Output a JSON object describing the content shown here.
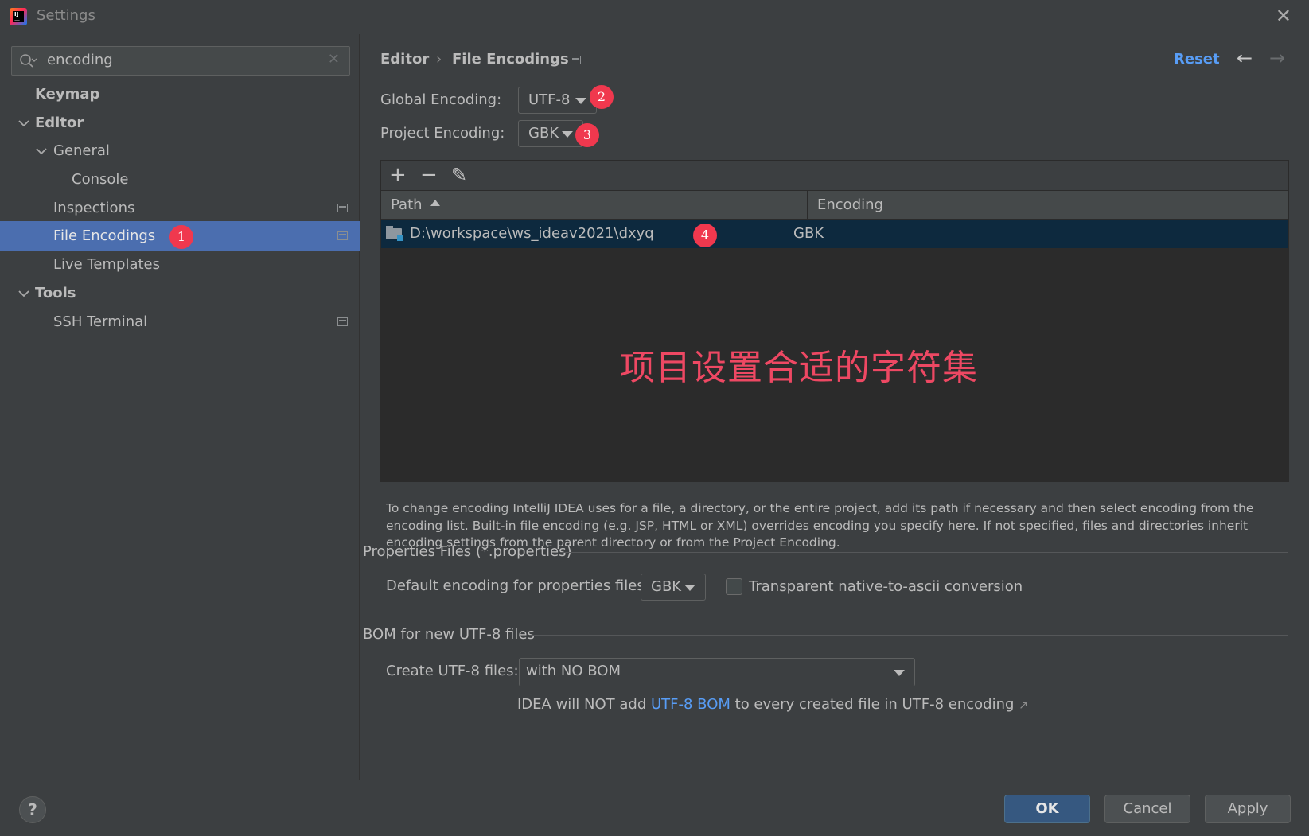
{
  "window": {
    "title": "Settings",
    "close_glyph": "✕"
  },
  "search": {
    "value": "encoding",
    "clear_glyph": "✕"
  },
  "sidebar": {
    "items": [
      {
        "label": "Keymap"
      },
      {
        "label": "Editor"
      },
      {
        "label": "General"
      },
      {
        "label": "Console"
      },
      {
        "label": "Inspections"
      },
      {
        "label": "File Encodings"
      },
      {
        "label": "Live Templates"
      },
      {
        "label": "Tools"
      },
      {
        "label": "SSH Terminal"
      }
    ]
  },
  "header": {
    "breadcrumb_parent": "Editor",
    "breadcrumb_sep": "›",
    "breadcrumb_current": "File Encodings",
    "reset_label": "Reset",
    "back_glyph": "←",
    "forward_glyph": "→"
  },
  "encodings": {
    "global_label": "Global Encoding:",
    "global_value": "UTF-8",
    "project_label": "Project Encoding:",
    "project_value": "GBK"
  },
  "table": {
    "toolbar": {
      "add": "+",
      "remove": "−",
      "edit": "✎"
    },
    "columns": {
      "path": "Path",
      "encoding": "Encoding"
    },
    "rows": [
      {
        "path": "D:\\workspace\\ws_ideav2021\\dxyq",
        "encoding": "GBK"
      }
    ],
    "annotation": "项目设置合适的字符集"
  },
  "help_text": "To change encoding IntelliJ IDEA uses for a file, a directory, or the entire project, add its path if necessary and then select encoding from the encoding list. Built-in file encoding (e.g. JSP, HTML or XML) overrides encoding you specify here. If not specified, files and directories inherit encoding settings from the parent directory or from the Project Encoding.",
  "properties": {
    "group_title": "Properties Files (*.properties)",
    "default_label": "Default encoding for properties files:",
    "default_value": "GBK",
    "checkbox_label": "Transparent native-to-ascii conversion",
    "checkbox_checked": false
  },
  "bom": {
    "group_title": "BOM for new UTF-8 files",
    "create_label": "Create UTF-8 files:",
    "create_value": "with NO BOM",
    "note_before": "IDEA will NOT add ",
    "note_link": "UTF-8 BOM",
    "note_after": " to every created file in UTF-8 encoding",
    "note_ext_glyph": "↗"
  },
  "badges": [
    "1",
    "2",
    "3",
    "4"
  ],
  "footer": {
    "help_glyph": "?",
    "ok_label": "OK",
    "cancel_label": "Cancel",
    "apply_label": "Apply"
  },
  "colors": {
    "accent_link": "#589df6",
    "selection": "#4b6eaf",
    "badge": "#f0384e",
    "annotation": "#ee4863"
  }
}
